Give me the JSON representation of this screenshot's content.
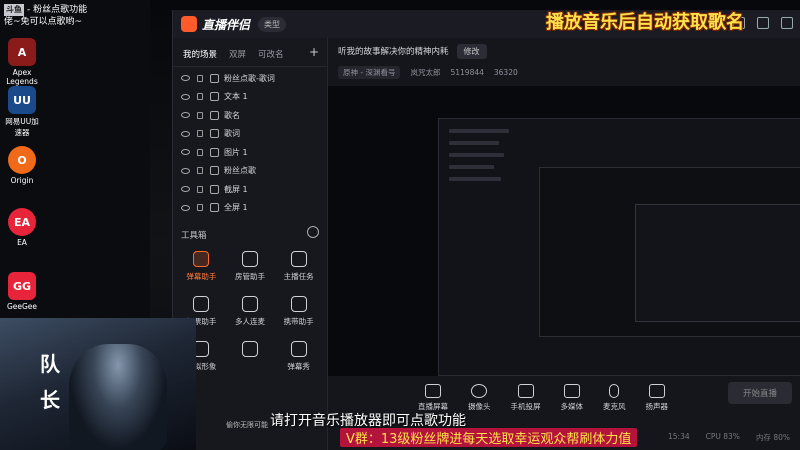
{
  "desktop": {
    "logo_badge": "斗鱼",
    "top_text_1": "- 粉丝点歌功能",
    "top_text_2": "佬~免可以点歌哟~",
    "icons": [
      {
        "label": "Apex Legends",
        "color": "#8b1b1b"
      },
      {
        "label": "网易UU加速器",
        "color": "#1a4a8a"
      },
      {
        "label": "Origin",
        "color": "#f06a1a"
      },
      {
        "label": "EA",
        "color": "#e8243a"
      },
      {
        "label": "GeeGee",
        "color": "#e8243a"
      }
    ],
    "calligraphy_top": "队",
    "calligraphy_bottom": "长"
  },
  "overlay_title": "播放音乐后自动获取歌名",
  "app": {
    "brand": "直播伴侣",
    "type_pill": "类型",
    "tabs": [
      "我的场景",
      "双屏",
      "可改名"
    ],
    "scenes": [
      "粉丝点歌-歌词",
      "文本 1",
      "歌名",
      "歌词",
      "图片 1",
      "粉丝点歌",
      "截屏 1",
      "全屏 1"
    ],
    "toolbox_title": "工具箱",
    "tools": [
      {
        "label": "弹幕助手",
        "hot": true
      },
      {
        "label": "房管助手",
        "hot": false
      },
      {
        "label": "主播任务",
        "hot": false
      },
      {
        "label": "投票助手",
        "hot": false
      },
      {
        "label": "多人连麦",
        "hot": false
      },
      {
        "label": "携带助手",
        "hot": false
      },
      {
        "label": "虚拟形象",
        "hot": false
      },
      {
        "label": "",
        "hot": false
      },
      {
        "label": "弹幕秀",
        "hot": false
      }
    ],
    "stage_title": "听我的故事解决你的精神内耗",
    "edit_label": "修改",
    "meta": [
      "原神 - 深渊看号",
      "岚咒太郎",
      "5119844",
      "36320"
    ],
    "controls": [
      "直播屏幕",
      "摄像头",
      "手机投屏",
      "多媒体",
      "麦克风",
      "扬声器"
    ],
    "start_label": "开始直播",
    "stats": [
      "15:34",
      "CPU 83%",
      "内存 80%"
    ]
  },
  "photo": {
    "word_1": "队",
    "word_2": "长"
  },
  "request_text": "请打开音乐播放器即可点歌功能",
  "vgroup_text": "V群：13级粉丝牌进每天选取幸运观众帮刷体力值",
  "small_caption": "偷你无限可能"
}
